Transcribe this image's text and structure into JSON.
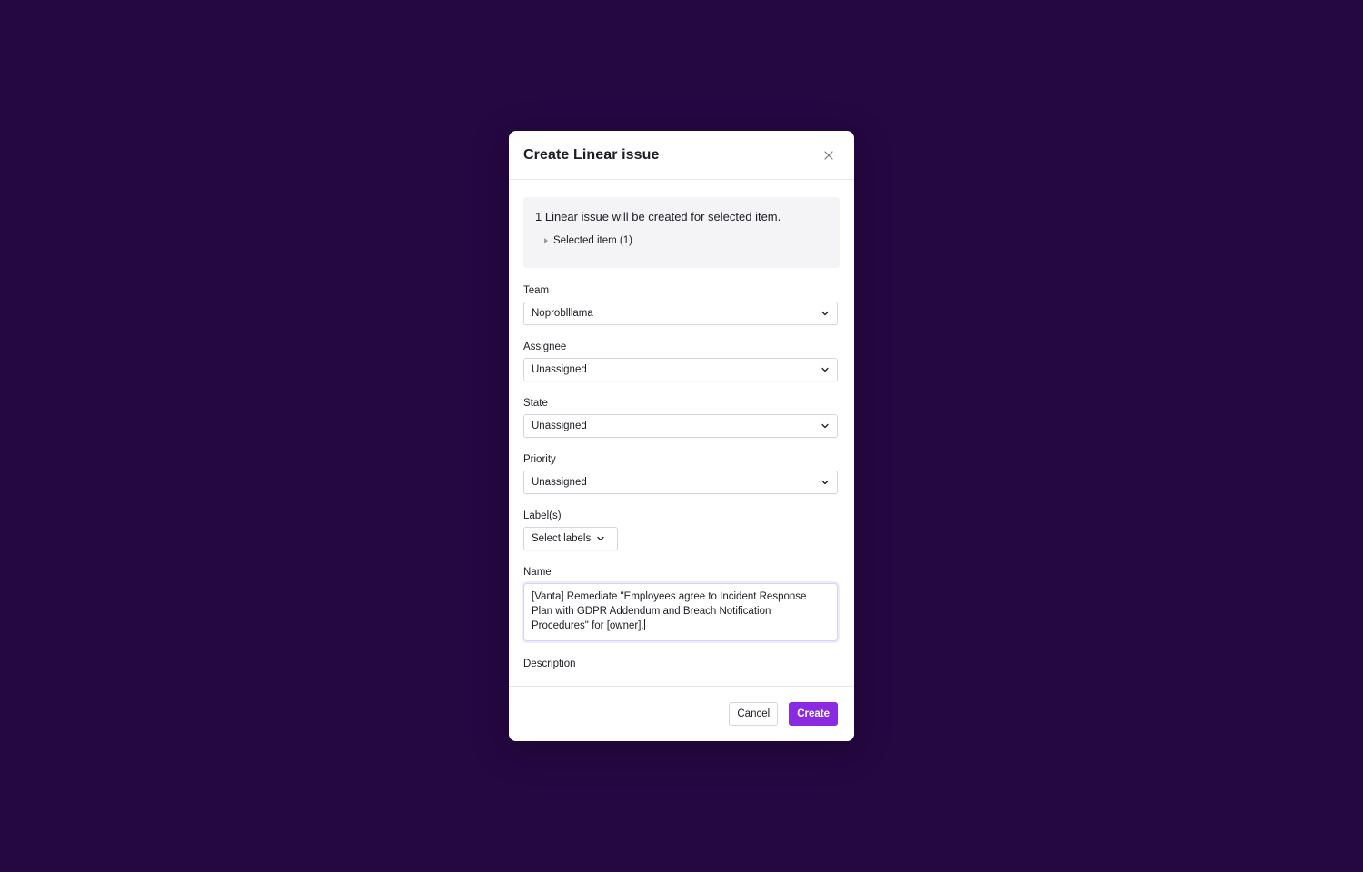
{
  "colors": {
    "backdrop": "#250742",
    "accent": "#8a2be2"
  },
  "modal": {
    "title": "Create Linear issue",
    "close_icon": "close-icon",
    "info": {
      "message": "1 Linear issue will be created for selected item.",
      "toggle_label": "Selected item (1)",
      "toggle_icon": "caret-right-icon"
    },
    "fields": {
      "team": {
        "label": "Team",
        "value": "Noproblllama"
      },
      "assignee": {
        "label": "Assignee",
        "value": "Unassigned"
      },
      "state": {
        "label": "State",
        "value": "Unassigned"
      },
      "priority": {
        "label": "Priority",
        "value": "Unassigned"
      },
      "labels": {
        "label": "Label(s)",
        "placeholder": "Select labels"
      },
      "name": {
        "label": "Name",
        "value": "[Vanta] Remediate \"Employees agree to Incident Response Plan with GDPR Addendum and Breach Notification Procedures\" for [owner]."
      },
      "description": {
        "label": "Description"
      }
    },
    "footer": {
      "cancel_label": "Cancel",
      "create_label": "Create"
    }
  }
}
